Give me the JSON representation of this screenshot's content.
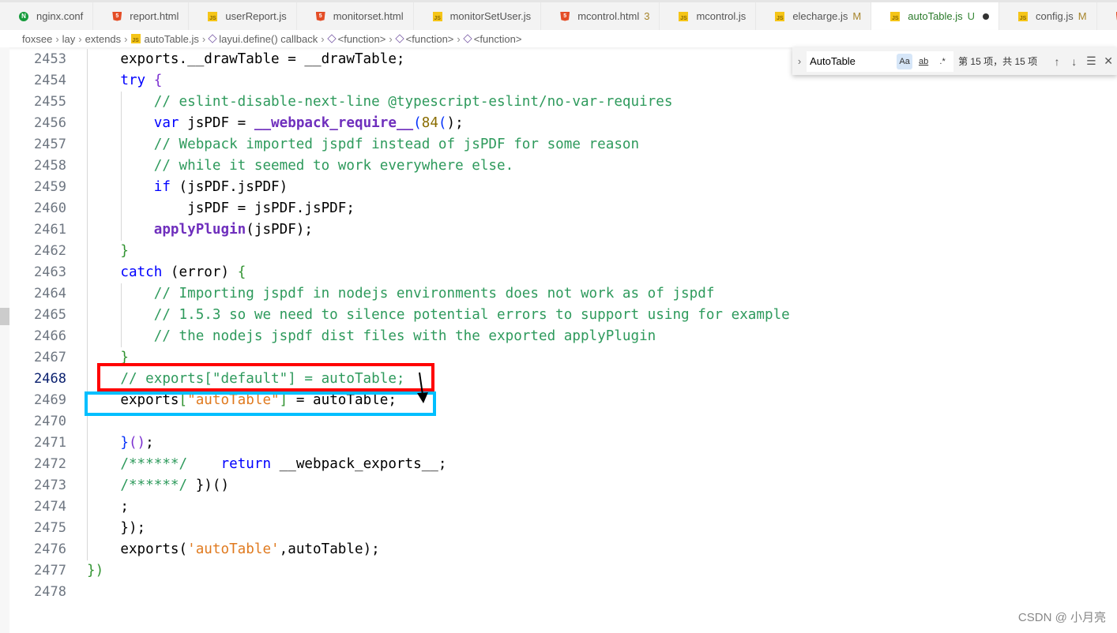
{
  "tabs": [
    {
      "label": "nginx.conf",
      "icon": "nginx-icon",
      "type": "nginx",
      "badge": ""
    },
    {
      "label": "report.html",
      "icon": "html-icon",
      "type": "html",
      "badge": ""
    },
    {
      "label": "userReport.js",
      "icon": "js-icon",
      "type": "js",
      "badge": ""
    },
    {
      "label": "monitorset.html",
      "icon": "html-icon",
      "type": "html",
      "badge": ""
    },
    {
      "label": "monitorSetUser.js",
      "icon": "js-icon",
      "type": "js",
      "badge": ""
    },
    {
      "label": "mcontrol.html",
      "icon": "html-icon",
      "type": "html",
      "badge": "3"
    },
    {
      "label": "mcontrol.js",
      "icon": "js-icon",
      "type": "js",
      "badge": ""
    },
    {
      "label": "elecharge.js",
      "icon": "js-icon",
      "type": "js",
      "badge": "M"
    },
    {
      "label": "autoTable.js",
      "icon": "js-icon",
      "type": "js",
      "badge": "U",
      "active": true,
      "dirty": true
    },
    {
      "label": "config.js",
      "icon": "js-icon",
      "type": "js",
      "badge": "M"
    },
    {
      "label": "",
      "icon": "html-icon",
      "type": "html",
      "badge": ""
    }
  ],
  "breadcrumb": [
    "foxsee",
    "lay",
    "extends",
    "autoTable.js",
    "layui.define() callback",
    "<function>",
    "<function>",
    "<function>"
  ],
  "find": {
    "value": "AutoTable",
    "match_case": "Aa",
    "whole_word": "ab",
    "regex": ".*",
    "count": "第 15 项，共 15 项",
    "match_case_on": true
  },
  "current_line": 2468,
  "lines": [
    {
      "n": 2453,
      "t": [
        [
          "    exports.__drawTable = __drawTable;",
          "pl"
        ]
      ]
    },
    {
      "n": 2454,
      "t": [
        [
          "    ",
          "pl"
        ],
        [
          "try",
          "kw"
        ],
        [
          " ",
          "pl"
        ],
        [
          "{",
          "br2"
        ]
      ]
    },
    {
      "n": 2455,
      "t": [
        [
          "        // eslint-disable-next-line @typescript-eslint/no-var-requires",
          "cm"
        ]
      ]
    },
    {
      "n": 2456,
      "t": [
        [
          "        ",
          "pl"
        ],
        [
          "var",
          "kw"
        ],
        [
          " jsPDF = ",
          "pl"
        ],
        [
          "__webpack_require__",
          "fn"
        ],
        [
          "(",
          "br3"
        ],
        [
          "84",
          "num"
        ],
        [
          "(",
          "br3"
        ],
        [
          ");",
          "pl"
        ]
      ]
    },
    {
      "n": 2457,
      "t": [
        [
          "        // Webpack imported jspdf instead of jsPDF for some reason",
          "cm"
        ]
      ]
    },
    {
      "n": 2458,
      "t": [
        [
          "        // while it seemed to work everywhere else.",
          "cm"
        ]
      ]
    },
    {
      "n": 2459,
      "t": [
        [
          "        ",
          "pl"
        ],
        [
          "if",
          "kw"
        ],
        [
          " (jsPDF.jsPDF)",
          "pl"
        ]
      ]
    },
    {
      "n": 2460,
      "t": [
        [
          "            jsPDF = jsPDF.jsPDF;",
          "pl"
        ]
      ]
    },
    {
      "n": 2461,
      "t": [
        [
          "        ",
          "pl"
        ],
        [
          "applyPlugin",
          "fn"
        ],
        [
          "(jsPDF);",
          "pl"
        ]
      ]
    },
    {
      "n": 2462,
      "t": [
        [
          "    ",
          "pl"
        ],
        [
          "}",
          "br"
        ]
      ]
    },
    {
      "n": 2463,
      "t": [
        [
          "    ",
          "pl"
        ],
        [
          "catch",
          "kw"
        ],
        [
          " (error) ",
          "pl"
        ],
        [
          "{",
          "br"
        ]
      ]
    },
    {
      "n": 2464,
      "t": [
        [
          "        // Importing jspdf in nodejs environments does not work as of jspdf",
          "cm"
        ]
      ]
    },
    {
      "n": 2465,
      "t": [
        [
          "        // 1.5.3 so we need to silence potential errors to support using for example",
          "cm"
        ]
      ]
    },
    {
      "n": 2466,
      "t": [
        [
          "        // the nodejs jspdf dist files with the exported applyPlugin",
          "cm"
        ]
      ]
    },
    {
      "n": 2467,
      "t": [
        [
          "    ",
          "pl"
        ],
        [
          "}",
          "br"
        ]
      ]
    },
    {
      "n": 2468,
      "t": [
        [
          "    // exports[\"default\"] = autoTable;",
          "cm"
        ]
      ]
    },
    {
      "n": 2469,
      "t": [
        [
          "    exports",
          "pl"
        ],
        [
          "[",
          "br"
        ],
        [
          "\"autoTable\"",
          "str"
        ],
        [
          "]",
          "br"
        ],
        [
          " = autoTable;",
          "pl"
        ]
      ]
    },
    {
      "n": 2470,
      "t": []
    },
    {
      "n": 2471,
      "t": [
        [
          "    ",
          "pl"
        ],
        [
          "}",
          "br3"
        ],
        [
          "()",
          "br2"
        ],
        [
          ";",
          "pl"
        ]
      ]
    },
    {
      "n": 2472,
      "t": [
        [
          "    /******/",
          "cm"
        ],
        [
          "    ",
          "pl"
        ],
        [
          "return",
          "kw"
        ],
        [
          " __webpack_exports__;",
          "pl"
        ]
      ]
    },
    {
      "n": 2473,
      "t": [
        [
          "    /******/",
          "cm"
        ],
        [
          " })()",
          "pl"
        ]
      ]
    },
    {
      "n": 2474,
      "t": [
        [
          "    ;",
          "pl"
        ]
      ]
    },
    {
      "n": 2475,
      "t": [
        [
          "    });",
          "pl"
        ]
      ]
    },
    {
      "n": 2476,
      "t": [
        [
          "    exports(",
          "pl"
        ],
        [
          "'autoTable'",
          "str"
        ],
        [
          ",autoTable);",
          "pl"
        ]
      ]
    },
    {
      "n": 2477,
      "t": [
        [
          "})",
          "br"
        ]
      ]
    },
    {
      "n": 2478,
      "t": []
    }
  ],
  "annotation_colors": {
    "red_box": "#ff0000",
    "blue_box": "#00bfff",
    "arrow": "#000000"
  },
  "watermark": "CSDN @ 小月亮"
}
